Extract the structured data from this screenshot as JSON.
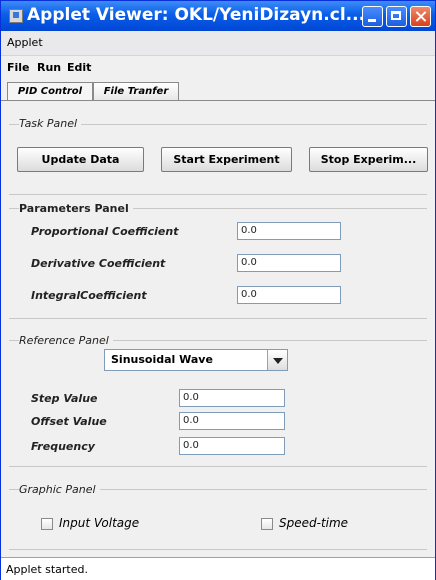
{
  "window": {
    "title": "Applet Viewer: OKL/YeniDizayn.cl..."
  },
  "menus": {
    "applet": "Applet",
    "file": "File",
    "run": "Run",
    "edit": "Edit"
  },
  "tabs": [
    {
      "label": "PID Control",
      "active": true
    },
    {
      "label": "File Tranfer",
      "active": false
    }
  ],
  "task_panel": {
    "title": "Task Panel",
    "update_label": "Update Data",
    "start_label": "Start Experiment",
    "stop_label": "Stop Experim..."
  },
  "parameters_panel": {
    "title": "Parameters Panel",
    "proportional_label": "Proportional Coefficient",
    "proportional_value": "0.0",
    "derivative_label": "Derivative Coefficient",
    "derivative_value": "0.0",
    "integral_label": "IntegralCoefficient",
    "integral_value": "0.0"
  },
  "reference_panel": {
    "title": "Reference Panel",
    "wave_selected": "Sinusoidal Wave",
    "step_label": "Step Value",
    "step_value": "0.0",
    "offset_label": "Offset  Value",
    "offset_value": "0.0",
    "frequency_label": "Frequency",
    "frequency_value": "0.0"
  },
  "graphic_panel": {
    "title": "Graphic Panel",
    "input_voltage_label": "Input Voltage",
    "speed_time_label": "Speed-time"
  },
  "status": {
    "text": "Applet started."
  }
}
